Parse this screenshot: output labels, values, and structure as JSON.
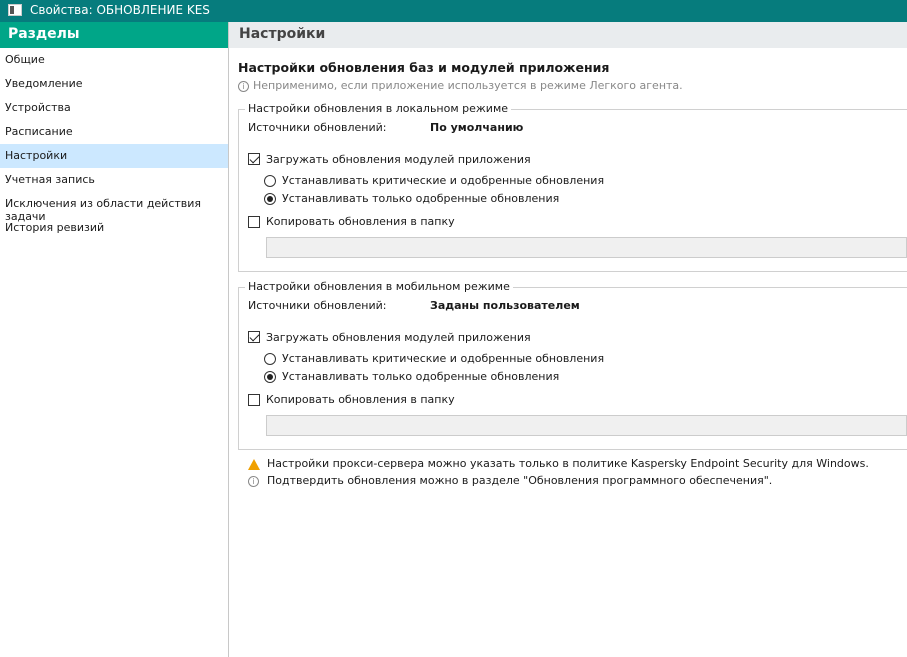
{
  "window": {
    "title": "Свойства: ОБНОВЛЕНИЕ KES"
  },
  "sidebar": {
    "title": "Разделы",
    "items": [
      {
        "label": "Общие"
      },
      {
        "label": "Уведомление"
      },
      {
        "label": "Устройства"
      },
      {
        "label": "Расписание"
      },
      {
        "label": "Настройки"
      },
      {
        "label": "Учетная запись"
      },
      {
        "label": "Исключения из области действия задачи"
      },
      {
        "label": "История ревизий"
      }
    ],
    "selected": "Настройки"
  },
  "main": {
    "title": "Настройки",
    "section_title": "Настройки обновления баз и модулей приложения",
    "note": "Неприменимо, если приложение используется в режиме Легкого агента.",
    "local": {
      "legend": "Настройки обновления в локальном режиме",
      "sources_label": "Источники обновлений:",
      "sources_value": "По умолчанию",
      "download_modules": "Загружать обновления модулей приложения",
      "download_checked": true,
      "radio_critical": "Устанавливать критические и одобренные обновления",
      "radio_approved": "Устанавливать только одобренные обновления",
      "selected_radio": "approved",
      "copy_label": "Копировать обновления в папку",
      "copy_checked": false,
      "folder_value": ""
    },
    "mobile": {
      "legend": "Настройки обновления в мобильном режиме",
      "sources_label": "Источники обновлений:",
      "sources_value": "Заданы пользователем",
      "download_modules": "Загружать обновления модулей приложения",
      "download_checked": true,
      "radio_critical": "Устанавливать критические и одобренные обновления",
      "radio_approved": "Устанавливать только одобренные обновления",
      "selected_radio": "approved",
      "copy_label": "Копировать обновления в папку",
      "copy_checked": false,
      "folder_value": ""
    },
    "warning": "Настройки прокси-сервера можно указать только в политике Kaspersky Endpoint Security для Windows.",
    "info": "Подтвердить обновления можно в разделе \"Обновления программного обеспечения\"."
  }
}
